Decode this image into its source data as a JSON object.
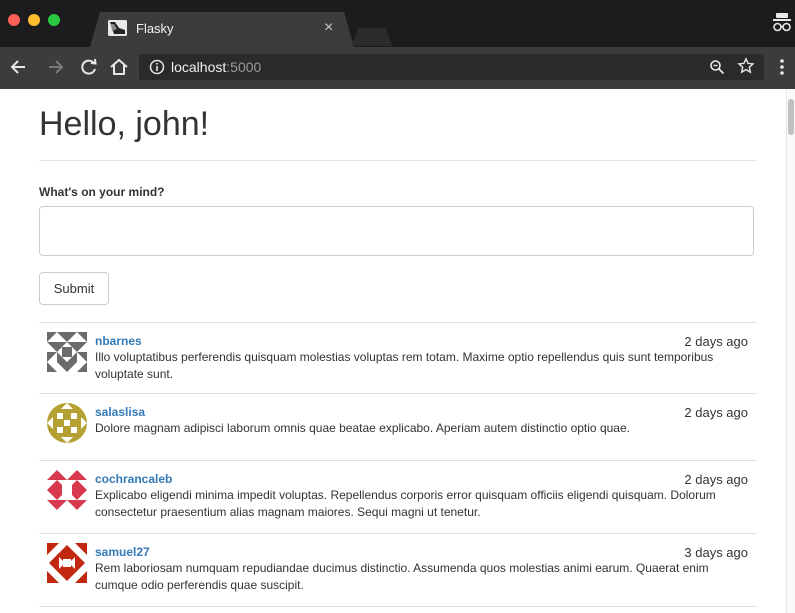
{
  "browser": {
    "tab_title": "Flasky",
    "tab_close": "×",
    "url_host": "localhost",
    "url_port": ":5000"
  },
  "page": {
    "heading": "Hello, john!",
    "form_label": "What's on your mind?",
    "textarea_value": "",
    "submit_label": "Submit"
  },
  "posts": [
    {
      "author": "nbarnes",
      "date": "2 days ago",
      "body": "Illo voluptatibus perferendis quisquam molestias voluptas rem totam. Maxime optio repellendus quis sunt temporibus voluptate sunt.",
      "avatar_color": "#6b6b6b"
    },
    {
      "author": "salaslisa",
      "date": "2 days ago",
      "body": "Dolore magnam adipisci laborum omnis quae beatae explicabo. Aperiam autem distinctio optio quae.",
      "avatar_color": "#b5a033"
    },
    {
      "author": "cochrancaleb",
      "date": "2 days ago",
      "body": "Explicabo eligendi minima impedit voluptas. Repellendus corporis error quisquam officiis eligendi quisquam. Dolorum consectetur praesentium alias magnam maiores. Sequi magni ut tenetur.",
      "avatar_color": "#d8394e"
    },
    {
      "author": "samuel27",
      "date": "3 days ago",
      "body": "Rem laboriosam numquam repudiandae ducimus distinctio. Assumenda quos molestias animi earum. Quaerat enim cumque odio perferendis quae suscipit.",
      "avatar_color": "#c2280f"
    }
  ]
}
